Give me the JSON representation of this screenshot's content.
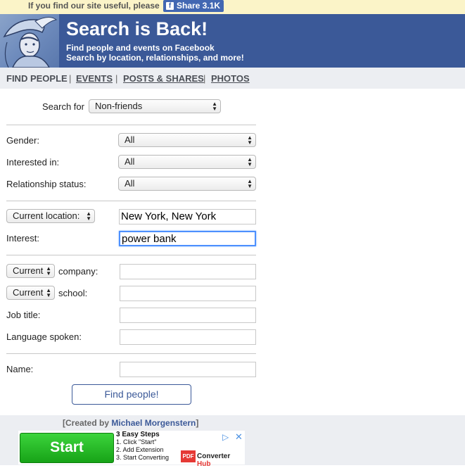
{
  "topbar": {
    "message": "If you find our site useful, please",
    "share_label": "Share 3.1K",
    "fb_glyph": "f"
  },
  "banner": {
    "title": "Search is Back!",
    "subtitle1": "Find people and events on Facebook",
    "subtitle2": "Search by location, relationships, and more!"
  },
  "nav": {
    "items": [
      {
        "label": "FIND PEOPLE"
      },
      {
        "label": "EVENTS"
      },
      {
        "label": "POSTS & SHARES"
      },
      {
        "label": "PHOTOS"
      }
    ],
    "separator": "|"
  },
  "form": {
    "search_for_label": "Search for",
    "search_for_value": "Non-friends",
    "gender_label": "Gender:",
    "gender_value": "All",
    "interested_label": "Interested in:",
    "interested_value": "All",
    "relationship_label": "Relationship status:",
    "relationship_value": "All",
    "location_select": "Current location:",
    "location_value": "New York, New York",
    "interest_label": "Interest:",
    "interest_value": "power bank",
    "company_select": "Current",
    "company_label": "company:",
    "company_value": "",
    "school_select": "Current",
    "school_label": "school:",
    "school_value": "",
    "jobtitle_label": "Job title:",
    "jobtitle_value": "",
    "language_label": "Language spoken:",
    "language_value": "",
    "name_label": "Name:",
    "name_value": "",
    "submit_label": "Find people!"
  },
  "footer": {
    "credit_prefix": "[Created by ",
    "credit_author": "Michael Morgenstern",
    "credit_suffix": "]"
  },
  "ad": {
    "start_label": "Start",
    "steps_title": "3 Easy Steps",
    "step1": "1. Click \"Start\"",
    "step2": "2. Add Extension",
    "step3": "3. Start Converting",
    "pdf_badge": "PDF",
    "converter_label": "Converter ",
    "hub_label": "Hub",
    "adchoices_glyph": "▷",
    "close_glyph": "✕"
  },
  "colors": {
    "brand": "#3b5998",
    "focus": "#4d90fe",
    "ad_green": "#17a317"
  }
}
